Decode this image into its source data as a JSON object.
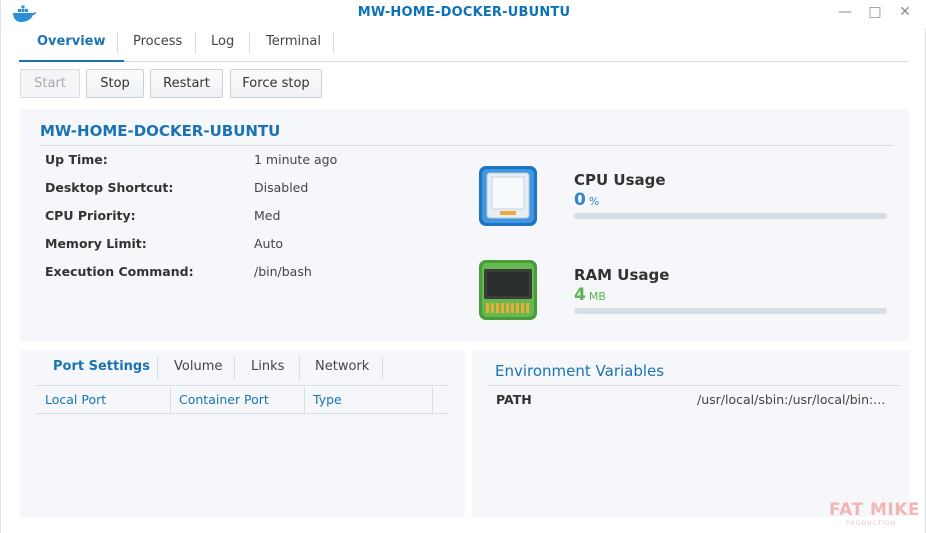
{
  "window": {
    "title": "MW-HOME-DOCKER-UBUNTU",
    "controls": {
      "minimize": "—",
      "maximize": "□",
      "close": "✕"
    }
  },
  "tabs": [
    {
      "label": "Overview",
      "active": true
    },
    {
      "label": "Process",
      "active": false
    },
    {
      "label": "Log",
      "active": false
    },
    {
      "label": "Terminal",
      "active": false
    }
  ],
  "actions": {
    "start": "Start",
    "stop": "Stop",
    "restart": "Restart",
    "force_stop": "Force stop"
  },
  "overview": {
    "name": "MW-HOME-DOCKER-UBUNTU",
    "info": [
      {
        "label": "Up Time:",
        "value": "1 minute ago"
      },
      {
        "label": "Desktop Shortcut:",
        "value": "Disabled"
      },
      {
        "label": "CPU Priority:",
        "value": "Med"
      },
      {
        "label": "Memory Limit:",
        "value": "Auto"
      },
      {
        "label": "Execution Command:",
        "value": "/bin/bash"
      }
    ],
    "cpu": {
      "title": "CPU Usage",
      "value": "0",
      "unit": "%",
      "level": 0,
      "color": "#2f86c8"
    },
    "ram": {
      "title": "RAM Usage",
      "value": "4",
      "unit": "MB",
      "level": 0,
      "color": "#5ab552"
    }
  },
  "ports": {
    "subtabs": [
      {
        "label": "Port Settings",
        "active": true
      },
      {
        "label": "Volume",
        "active": false
      },
      {
        "label": "Links",
        "active": false
      },
      {
        "label": "Network",
        "active": false
      }
    ],
    "columns": [
      "Local Port",
      "Container Port",
      "Type"
    ]
  },
  "env": {
    "title": "Environment Variables",
    "rows": [
      {
        "key": "PATH",
        "value": "/usr/local/sbin:/usr/local/bin:..."
      }
    ]
  },
  "watermark": {
    "main": "FAT MIKE",
    "sub": "PRODUCTION"
  },
  "icons": {
    "app": "docker-whale-icon",
    "cpu": "cpu-chip-icon",
    "ram": "ram-module-icon"
  }
}
